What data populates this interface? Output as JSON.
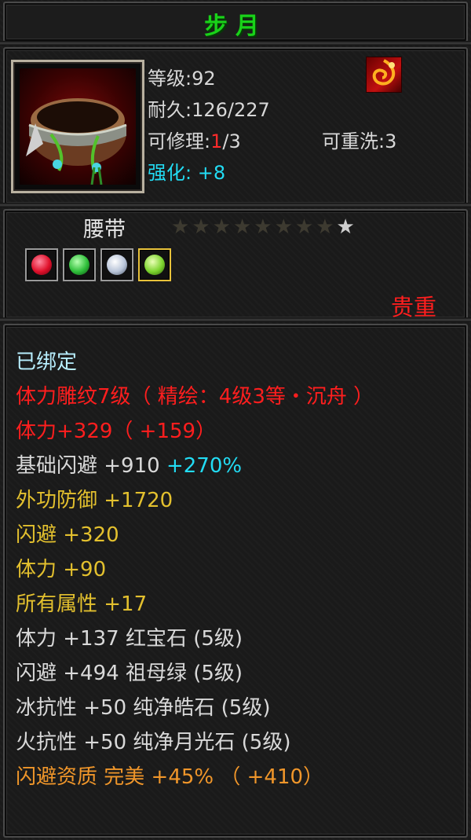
{
  "item": {
    "title": "步月",
    "level_label": "等级",
    "level": "92",
    "durability_label": "耐久",
    "durability": "126/227",
    "repair_label": "可修理",
    "repair_current": "1",
    "repair_max": "/3",
    "rewash_label": "可重洗",
    "rewash": "3",
    "enhance_label": "强化",
    "enhance": "+8",
    "type": "腰带",
    "stars_total": 9,
    "stars_lit": 1,
    "rarity": "贵重",
    "icon_name": "belt-item-icon",
    "badge_icon": "fire-swirl-icon"
  },
  "gems": [
    {
      "name": "ruby-gem-icon",
      "color": "#e0102a"
    },
    {
      "name": "emerald-gem-icon",
      "color": "#2fbf3a"
    },
    {
      "name": "diamond-gem-icon",
      "color": "#b8c4d8"
    },
    {
      "name": "moonstone-gem-icon",
      "color": "#7cd42e"
    }
  ],
  "attributes": {
    "bound": "已绑定",
    "engrave": "体力雕纹7级（ 精绘：4级3等・沉舟 ）",
    "stamina_main": "体力+329（ +159）",
    "dodge_base_label": "基础闪避  +910",
    "dodge_base_pct": " +270%",
    "ext_defense": "外功防御  +1720",
    "dodge": "闪避  +320",
    "stamina": "体力  +90",
    "all_attr": "所有属性  +17",
    "gem_stamina": "体力  +137  红宝石 (5级)",
    "gem_dodge": "闪避  +494  祖母绿 (5级)",
    "gem_ice": "冰抗性  +50  纯净皓石 (5级)",
    "gem_fire": "火抗性  +50  纯净月光石 (5级)",
    "quality": "闪避资质    完美  +45%  （ +410）"
  }
}
